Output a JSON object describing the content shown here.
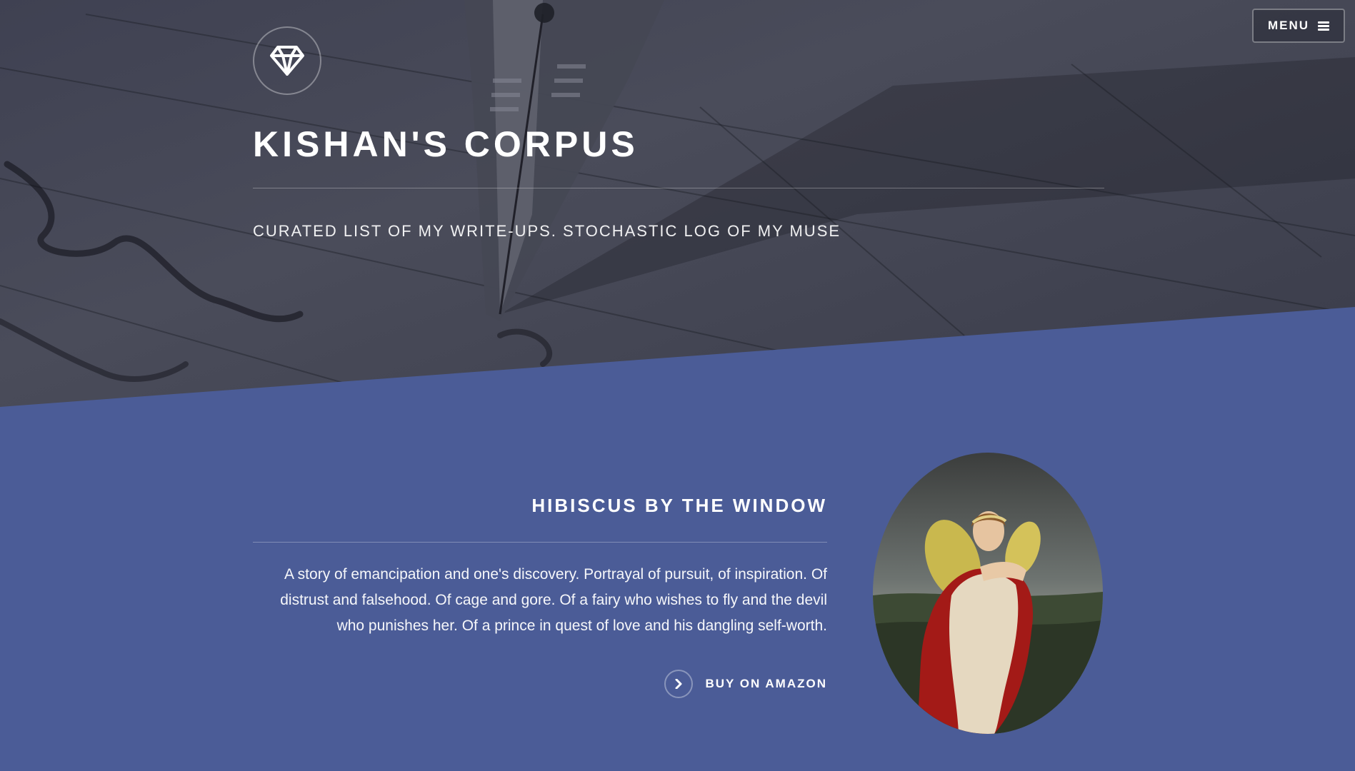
{
  "header": {
    "menu_label": "MENU",
    "title": "KISHAN'S CORPUS",
    "tagline": "CURATED LIST OF MY WRITE-UPS. STOCHASTIC LOG OF MY MUSE",
    "logo_icon": "diamond-icon"
  },
  "feature": {
    "title": "HIBISCUS BY THE WINDOW",
    "description": "A story of emancipation and one's discovery. Portrayal of pursuit, of inspiration. Of distrust and falsehood. Of cage and gore. Of a fairy who wishes to fly and the devil who punishes her. Of a prince in quest of love and his dangling self-worth.",
    "cta_label": "BUY ON AMAZON",
    "cta_icon": "chevron-right-icon"
  },
  "colors": {
    "section_bg": "#4b5c97",
    "hero_bg": "#40424f"
  }
}
